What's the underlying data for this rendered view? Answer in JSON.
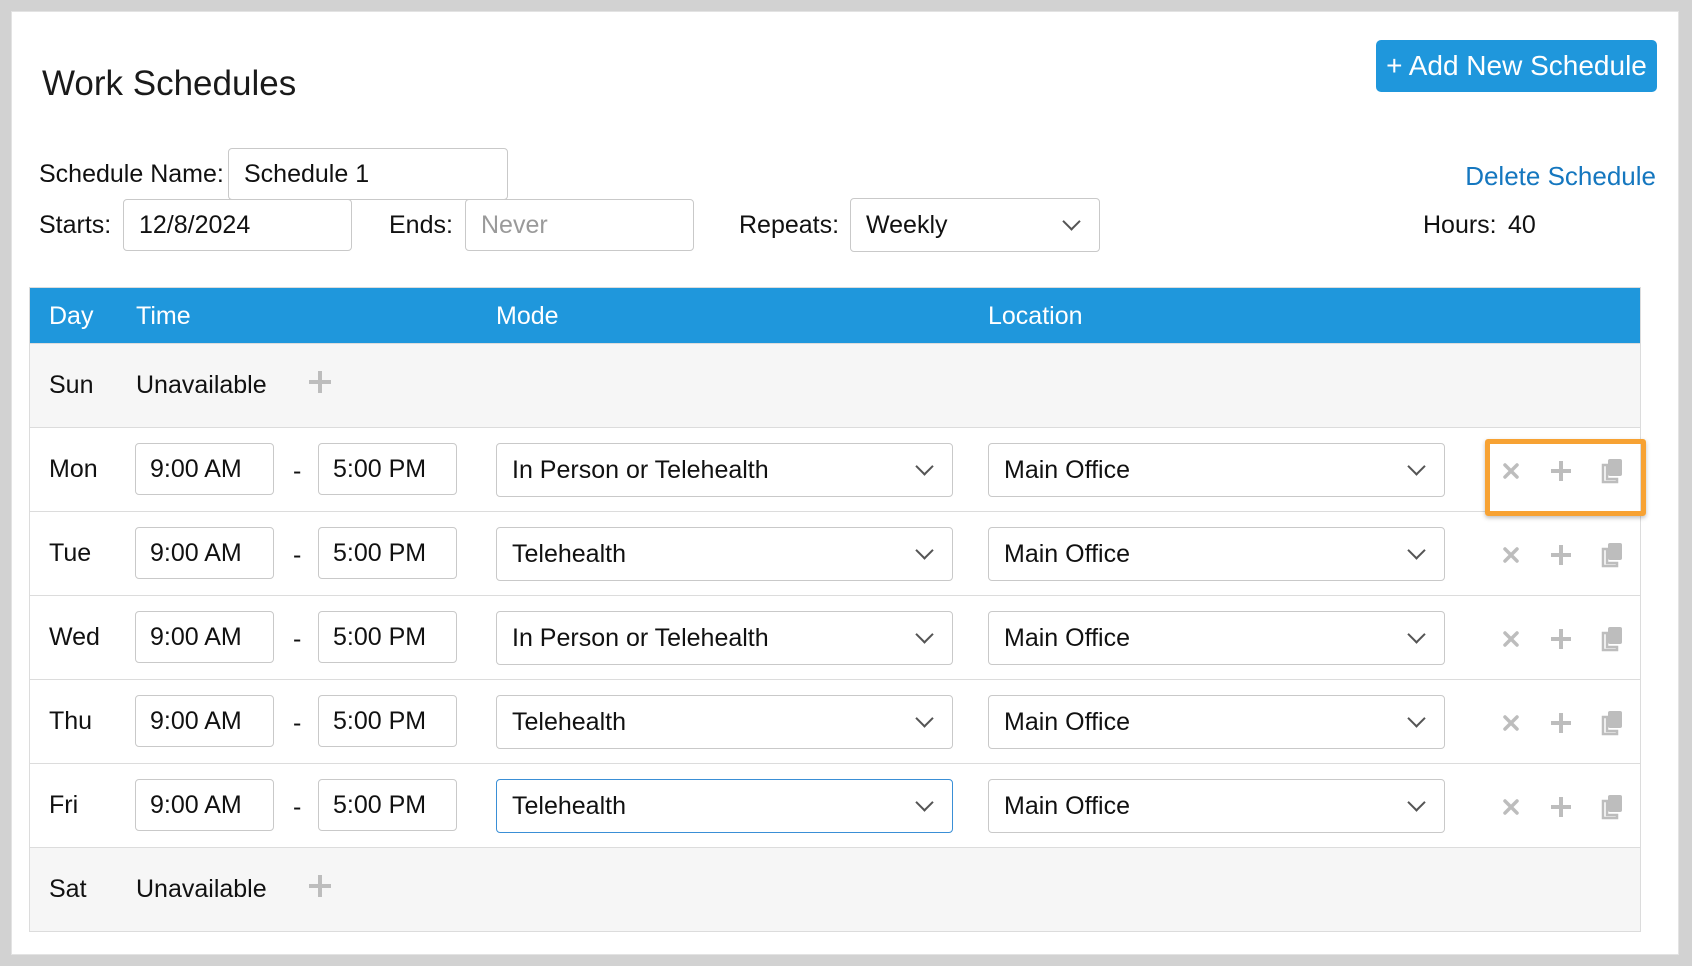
{
  "header": {
    "title": "Work Schedules",
    "add_button_label": "+ Add New Schedule"
  },
  "form": {
    "schedule_name_label": "Schedule Name:",
    "schedule_name_value": "Schedule 1",
    "starts_label": "Starts:",
    "starts_value": "12/8/2024",
    "ends_label": "Ends:",
    "ends_placeholder": "Never",
    "repeats_label": "Repeats:",
    "repeats_value": "Weekly",
    "delete_label": "Delete Schedule",
    "hours_label": "Hours:",
    "hours_value": "40"
  },
  "table": {
    "headers": {
      "day": "Day",
      "time": "Time",
      "mode": "Mode",
      "location": "Location"
    },
    "rows": [
      {
        "day": "Sun",
        "unavailable": "Unavailable"
      },
      {
        "day": "Mon",
        "start": "9:00 AM",
        "sep": "-",
        "end": "5:00 PM",
        "mode": "In Person or Telehealth",
        "location": "Main Office"
      },
      {
        "day": "Tue",
        "start": "9:00 AM",
        "sep": "-",
        "end": "5:00 PM",
        "mode": "Telehealth",
        "location": "Main Office"
      },
      {
        "day": "Wed",
        "start": "9:00 AM",
        "sep": "-",
        "end": "5:00 PM",
        "mode": "In Person or Telehealth",
        "location": "Main Office"
      },
      {
        "day": "Thu",
        "start": "9:00 AM",
        "sep": "-",
        "end": "5:00 PM",
        "mode": "Telehealth",
        "location": "Main Office"
      },
      {
        "day": "Fri",
        "start": "9:00 AM",
        "sep": "-",
        "end": "5:00 PM",
        "mode": "Telehealth",
        "location": "Main Office"
      },
      {
        "day": "Sat",
        "unavailable": "Unavailable"
      }
    ]
  },
  "icons": {
    "row_actions": [
      "close-icon",
      "plus-icon",
      "copy-icon"
    ],
    "add_time": "plus-icon"
  },
  "colors": {
    "accent": "#1f97dc",
    "link": "#1577bf",
    "highlight": "#f7a233",
    "icon_gray": "#bdbdbd"
  }
}
